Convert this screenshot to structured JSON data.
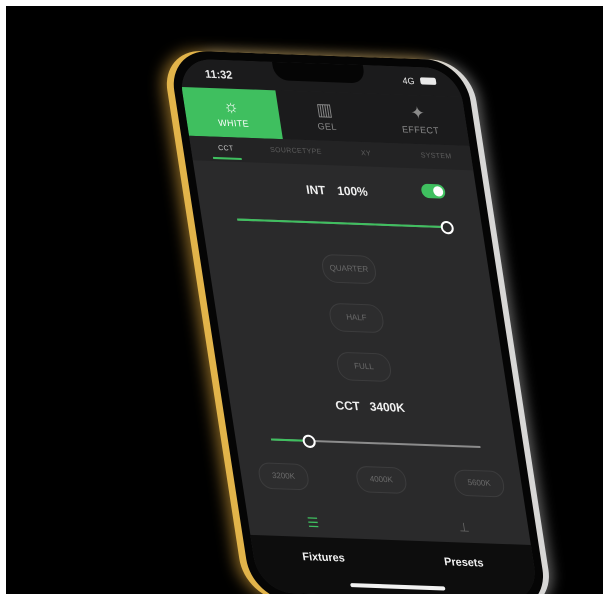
{
  "status_bar": {
    "time": "11:32",
    "signal": "4G"
  },
  "mode_tabs": [
    {
      "label": "WHITE",
      "icon": "sun-icon",
      "active": true
    },
    {
      "label": "GEL",
      "icon": "gel-icon",
      "active": false
    },
    {
      "label": "EFFECT",
      "icon": "sparkle-icon",
      "active": false
    }
  ],
  "sub_tabs": [
    {
      "label": "CCT",
      "active": true
    },
    {
      "label": "SOURCETYPE",
      "active": false
    },
    {
      "label": "XY",
      "active": false
    },
    {
      "label": "SYSTEM",
      "active": false
    }
  ],
  "intensity": {
    "label": "INT",
    "value_text": "100%",
    "value": 1.0,
    "enabled": true
  },
  "intensity_presets": [
    "QUARTER",
    "HALF",
    "FULL"
  ],
  "cct": {
    "label": "CCT",
    "value_text": "3400K",
    "value": 0.18
  },
  "cct_presets": [
    "3200K",
    "4000K",
    "5600K"
  ],
  "bottom_nav": {
    "left": "Fixtures",
    "right": "Presets"
  },
  "colors": {
    "accent": "#3fbf5f",
    "background": "#2a2a2b",
    "frame_gold": "#e2b44a"
  }
}
